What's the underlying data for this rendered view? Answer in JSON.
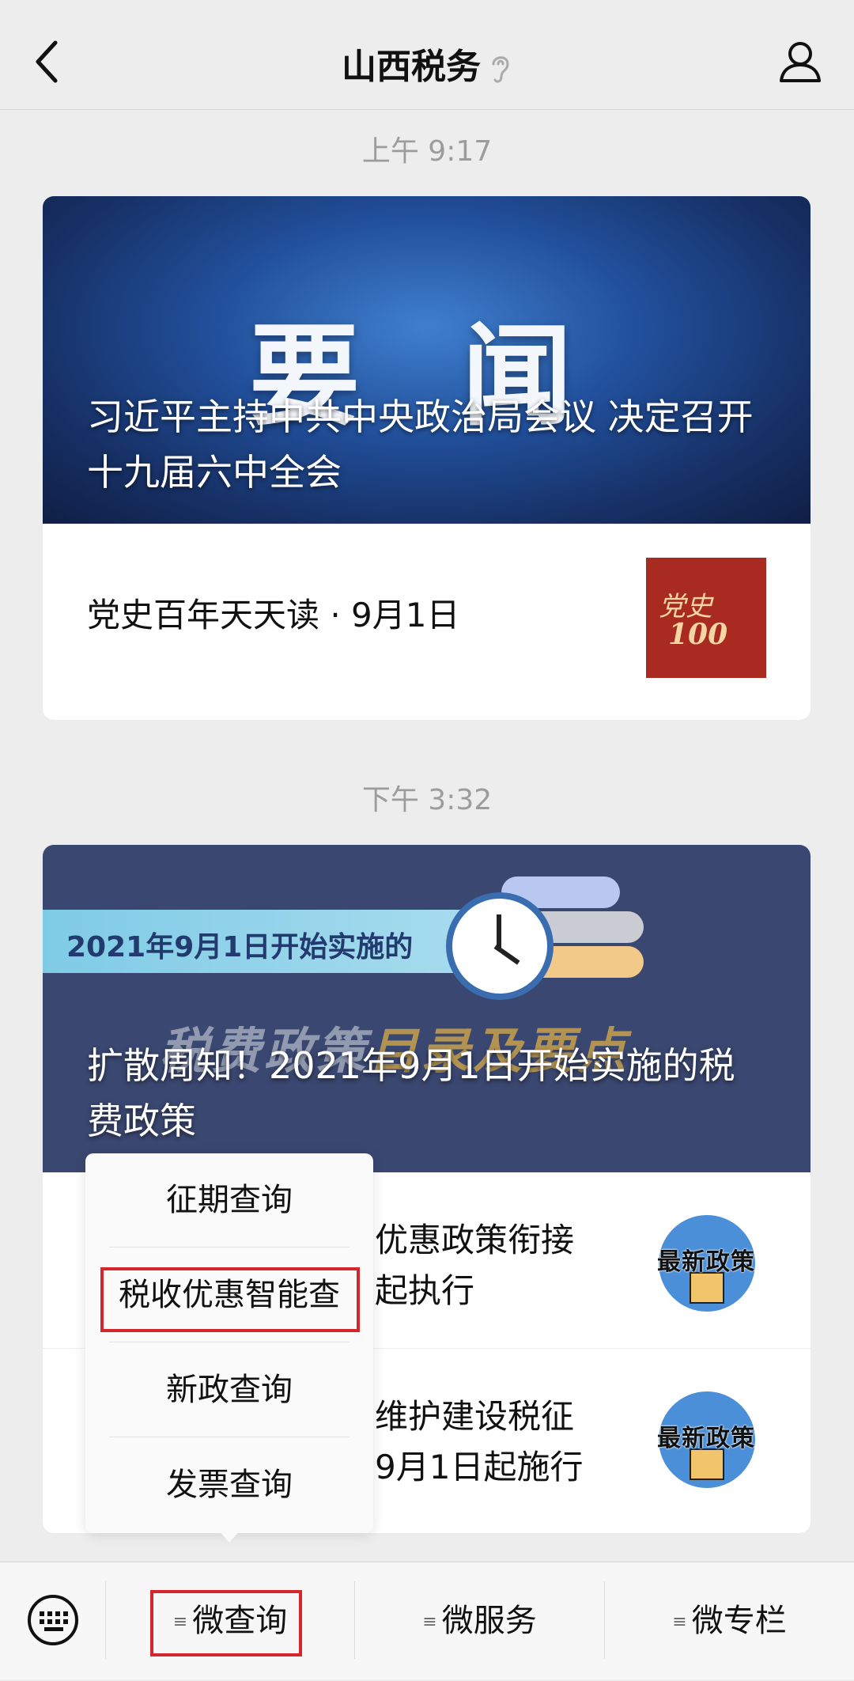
{
  "header": {
    "title": "山西税务"
  },
  "messages": [
    {
      "time": "上午 9:17",
      "banner_big_title": "要 闻",
      "headline": "习近平主持中共中央政治局会议 决定召开十九届六中全会",
      "sub_title": "党史百年天天读 · 9月1日",
      "thumb_text1": "党史",
      "thumb_text2": "100"
    },
    {
      "time": "下午 3:32",
      "ribbon_text": "2021年9月1日开始实施的",
      "watermark_a": "税费政策",
      "watermark_b": "目录及要点",
      "headline": "扩散周知！2021年9月1日开始实施的税费政策",
      "items": [
        {
          "text": "优惠政策衔接\n起执行",
          "badge": "最新政策"
        },
        {
          "text": "维护建设税征\n9月1日起施行",
          "badge": "最新政策"
        }
      ]
    }
  ],
  "popup_menu": {
    "items": [
      "征期查询",
      "税收优惠智能查",
      "新政查询",
      "发票查询"
    ],
    "highlighted_item": "税收优惠智能查"
  },
  "bottom_menu": {
    "items": [
      "微查询",
      "微服务",
      "微专栏"
    ],
    "highlighted_item": "微查询"
  },
  "colors": {
    "highlight_border": "#d6262b",
    "background": "#ededed"
  }
}
